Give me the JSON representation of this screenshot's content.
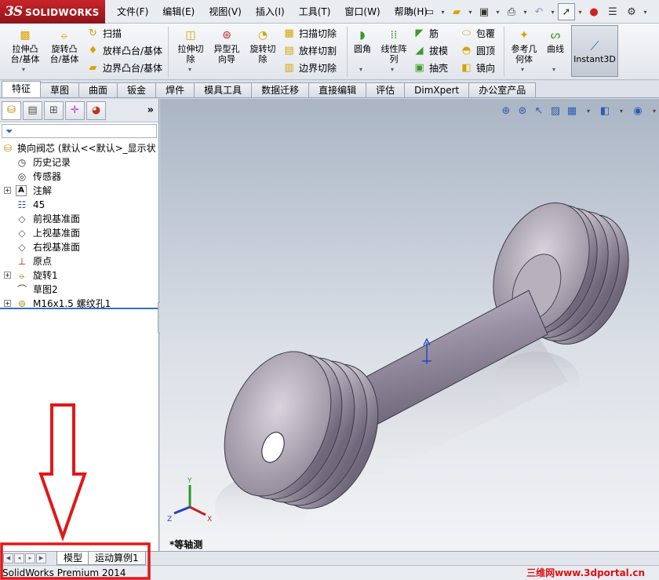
{
  "app": {
    "logo_ds": "3S",
    "logo_text": "SOLIDWORKS",
    "menu": [
      "文件(F)",
      "编辑(E)",
      "视图(V)",
      "插入(I)",
      "工具(T)",
      "窗口(W)",
      "帮助(H)"
    ]
  },
  "command_manager": {
    "extrude_boss": "拉伸凸\n台/基体",
    "revolve_boss": "旋转凸\n台/基体",
    "sweep": "扫描",
    "loft_boss": "放样凸台/基体",
    "boundary_boss": "边界凸台/基体",
    "extrude_cut": "拉伸切\n除",
    "hole_wizard": "异型孔\n向导",
    "revolve_cut": "旋转切\n除",
    "swept_cut": "扫描切除",
    "lofted_cut": "放样切割",
    "boundary_cut": "边界切除",
    "fillet": "圆角",
    "linear_pattern": "线性阵\n列",
    "rib": "筋",
    "draft": "拔模",
    "shell": "抽壳",
    "wrap": "包覆",
    "dome": "圆顶",
    "mirror": "镜向",
    "ref_geometry": "参考几\n何体",
    "curves": "曲线",
    "instant3d": "Instant3D"
  },
  "tabs": [
    "特征",
    "草图",
    "曲面",
    "钣金",
    "焊件",
    "模具工具",
    "数据迁移",
    "直接编辑",
    "评估",
    "DimXpert",
    "办公室产品"
  ],
  "active_tab": 0,
  "tree": {
    "root": "换向阀芯 (默认<<默认>_显示状",
    "items": [
      {
        "label": "历史记录",
        "icon": "history-icon"
      },
      {
        "label": "传感器",
        "icon": "sensor-icon"
      },
      {
        "label": "注解",
        "icon": "annotation-icon"
      },
      {
        "label": "45",
        "icon": "material-icon"
      },
      {
        "label": "前视基准面",
        "icon": "plane-icon"
      },
      {
        "label": "上视基准面",
        "icon": "plane-icon"
      },
      {
        "label": "右视基准面",
        "icon": "plane-icon"
      },
      {
        "label": "原点",
        "icon": "origin-icon"
      },
      {
        "label": "旋转1",
        "icon": "revolve-icon"
      },
      {
        "label": "草图2",
        "icon": "sketch-icon"
      },
      {
        "label": "M16x1.5 螺纹孔1",
        "icon": "hole-icon"
      }
    ]
  },
  "viewport": {
    "view_name": "*等轴测",
    "triad": {
      "x": "X",
      "y": "Y",
      "z": "Z"
    }
  },
  "bottom_tabs": [
    "模型",
    "运动算例1"
  ],
  "status": {
    "text": "SolidWorks Premium 2014",
    "watermark": "三维网www.3dportal.cn"
  },
  "colors": {
    "annotation_red": "#e01818",
    "brand_red": "#c8242b",
    "rollback_blue": "#2f6fd0"
  }
}
